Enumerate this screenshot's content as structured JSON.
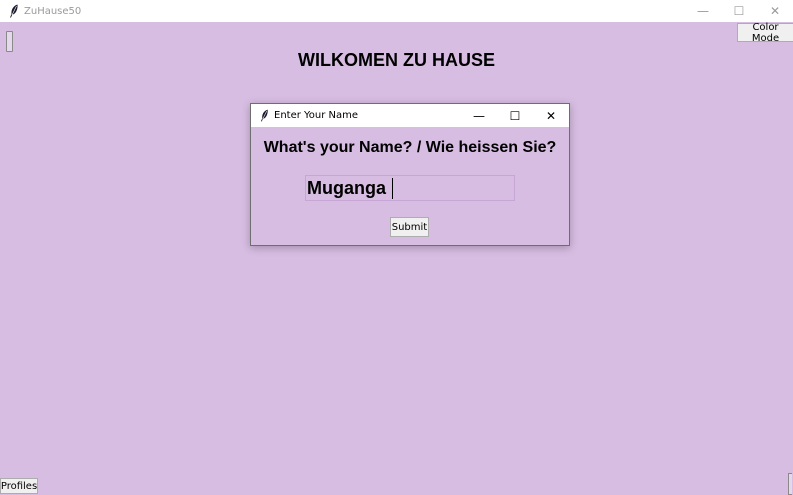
{
  "app": {
    "title": "ZuHause50",
    "icon": "feather-icon",
    "background_color": "#d7bde2"
  },
  "window_controls": {
    "minimize": "—",
    "maximize": "☐",
    "close": "✕"
  },
  "toolbar": {
    "color_mode_label": "Color Mode"
  },
  "main": {
    "heading": "WILKOMEN ZU HAUSE"
  },
  "footer": {
    "profiles_label": "Profiles"
  },
  "dialog": {
    "title": "Enter Your Name",
    "icon": "feather-icon",
    "question": "What's your Name? / Wie heissen Sie?",
    "name_value": "Muganga",
    "submit_label": "Submit",
    "controls": {
      "minimize": "—",
      "maximize": "☐",
      "close": "✕"
    }
  }
}
